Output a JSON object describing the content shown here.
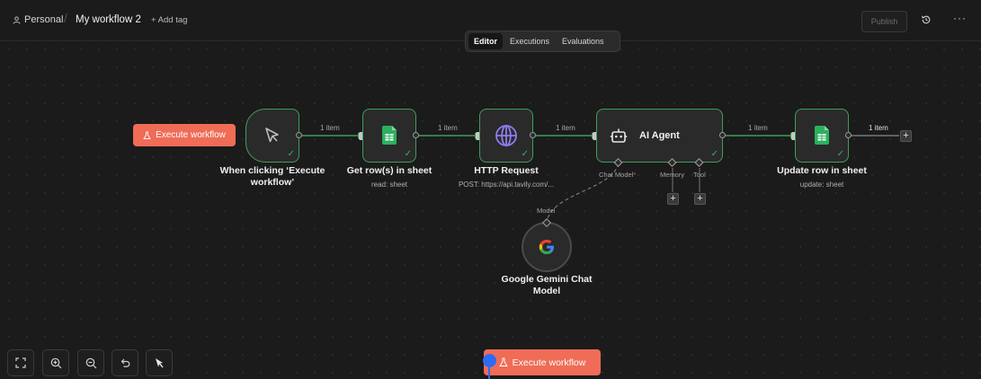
{
  "header": {
    "project": "Personal",
    "workflow_name": "My workflow 2",
    "add_tag": "+ Add tag",
    "publish": "Publish",
    "more": "···"
  },
  "tabs": [
    {
      "label": "Editor",
      "active": true
    },
    {
      "label": "Executions",
      "active": false
    },
    {
      "label": "Evaluations",
      "active": false
    }
  ],
  "colors": {
    "accent": "#ef6c57",
    "success": "#3fae63",
    "canvas": "#1b1b1b"
  },
  "canvas": {
    "execute_button_top": "Execute workflow",
    "execute_button_bottom": "Execute workflow",
    "nodes": {
      "trigger": {
        "title": "When clicking ‘Execute workflow’",
        "icon": "cursor-icon"
      },
      "get_rows": {
        "title": "Get row(s) in sheet",
        "subtitle": "read: sheet",
        "icon": "google-sheets-icon"
      },
      "http": {
        "title": "HTTP Request",
        "subtitle": "POST: https://api.tavily.com/...",
        "icon": "globe-icon"
      },
      "agent": {
        "title": "AI Agent",
        "icon": "robot-icon",
        "sub_ports": [
          {
            "label": "Chat Model",
            "required": true
          },
          {
            "label": "Memory",
            "required": false
          },
          {
            "label": "Tool",
            "required": false
          }
        ]
      },
      "gemini": {
        "title": "Google Gemini Chat Model",
        "port_label": "Model",
        "icon": "google-g-icon"
      },
      "update_row": {
        "title": "Update row in sheet",
        "subtitle": "update: sheet",
        "icon": "google-sheets-icon"
      }
    },
    "edges": [
      "1 item",
      "1 item",
      "1 item",
      "1 item",
      "1 item"
    ]
  },
  "toolbar": [
    "fit-view",
    "zoom-in",
    "zoom-out",
    "undo",
    "tidy-up"
  ]
}
